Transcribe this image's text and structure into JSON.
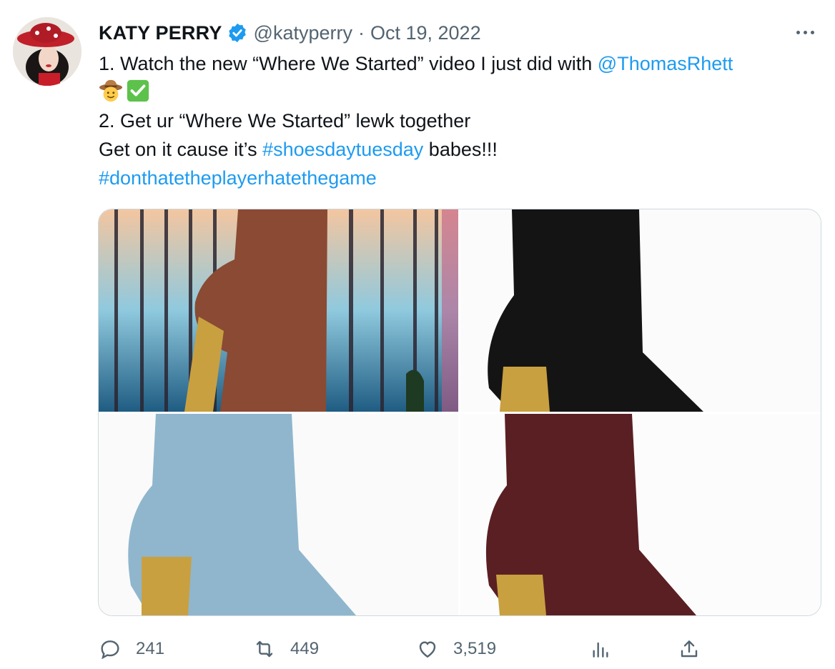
{
  "author": {
    "name": "KATY PERRY",
    "handle": "@katyperry",
    "separator": "·",
    "date": "Oct 19, 2022"
  },
  "icons": {
    "verified": "verified-badge-icon",
    "more": "more-options-icon",
    "reply": "reply-icon",
    "retweet": "retweet-icon",
    "like": "heart-icon",
    "analytics": "analytics-icon",
    "share": "share-icon"
  },
  "tweet": {
    "line1_text": "1. Watch the new “Where We Started” video I just did with ",
    "line1_mention": "@ThomasRhett",
    "line2_emoji": [
      "cowboy-face-emoji",
      "check-mark-button-emoji"
    ],
    "line3_text": "2. Get ur “Where We Started” lewk together",
    "line4_pre": "Get on it cause it’s ",
    "line4_hashtag": "#shoesdaytuesday",
    "line4_post": " babes!!!",
    "line5_hashtag": "#donthatetheplayerhatethegame"
  },
  "media": [
    {
      "name": "brown-boot-photo",
      "color": "#8a4a33"
    },
    {
      "name": "black-boot-photo",
      "color": "#141414"
    },
    {
      "name": "blue-boot-photo",
      "color": "#8fb6cd"
    },
    {
      "name": "burgundy-boot-photo",
      "color": "#5a1f22"
    }
  ],
  "actions": {
    "replies": "241",
    "retweets": "449",
    "likes": "3,519"
  },
  "colors": {
    "link": "#1d9bf0",
    "muted": "#536471",
    "text": "#0f1419",
    "border": "#cfd9de"
  }
}
